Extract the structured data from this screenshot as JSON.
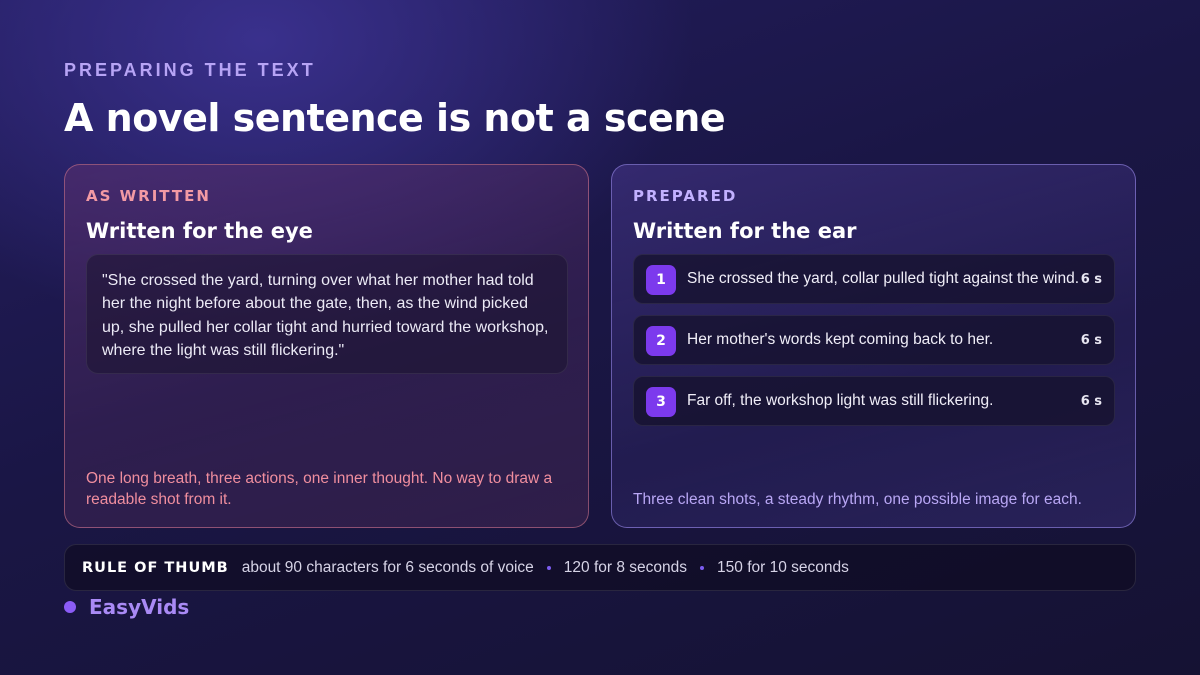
{
  "slide": {
    "eyebrow": "PREPARING THE TEXT",
    "title": "A novel sentence is not a scene"
  },
  "left_card": {
    "label": "AS WRITTEN",
    "heading": "Written for the eye",
    "quote": "\"She crossed the yard, turning over what her mother had told her the night before about the gate, then, as the wind picked up, she pulled her collar tight and hurried toward the workshop, where the light was still flickering.\"",
    "footnote": "One long breath, three actions, one inner thought. No way to draw a readable shot from it."
  },
  "right_card": {
    "label": "PREPARED",
    "heading": "Written for the ear",
    "steps": [
      {
        "number": "1",
        "text": "She crossed the yard, collar pulled tight against the wind.",
        "duration": "6 s"
      },
      {
        "number": "2",
        "text": "Her mother's words kept coming back to her.",
        "duration": "6 s"
      },
      {
        "number": "3",
        "text": "Far off, the workshop light was still flickering.",
        "duration": "6 s"
      }
    ],
    "footnote": "Three clean shots, a steady rhythm, one possible image for each."
  },
  "rule_of_thumb": {
    "label": "RULE OF THUMB",
    "items": [
      "about 90 characters for 6 seconds of voice",
      "120 for 8 seconds",
      "150 for 10 seconds"
    ]
  },
  "brand": {
    "name": "EasyVids",
    "accent_color": "#8b5cf6"
  }
}
